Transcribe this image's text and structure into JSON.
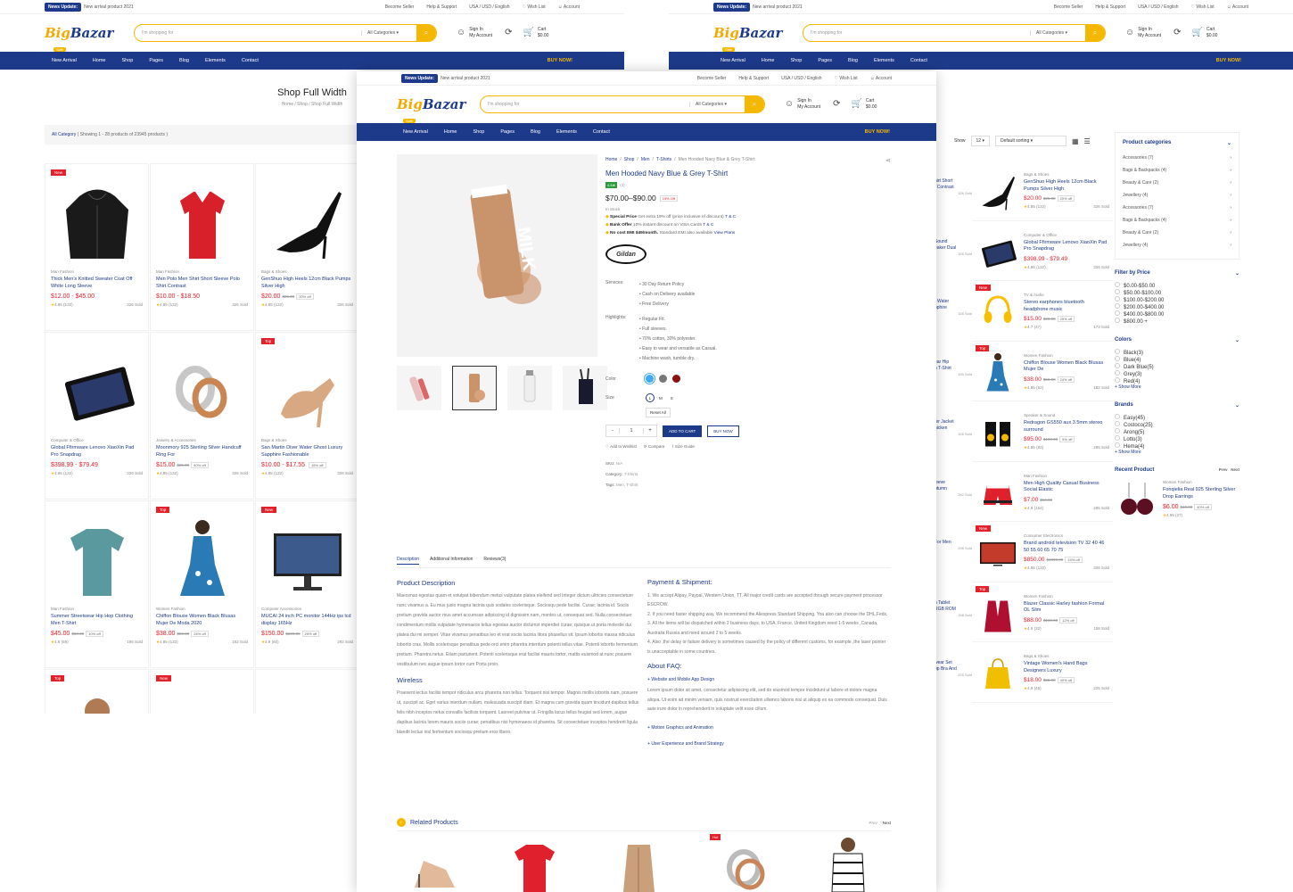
{
  "top": {
    "badge": "News Update:",
    "news": "New arrival product 2021",
    "links": [
      "Become Seller",
      "Help & Support",
      "USA / USD / English",
      "Wish List",
      "Account"
    ]
  },
  "logo": {
    "a": "Big",
    "b": "Bazar"
  },
  "search": {
    "placeholder": "I'm shopping for",
    "category": "All Categories"
  },
  "account": {
    "l1": "Sign In",
    "l2": "My Account",
    "cart": "Cart",
    "amount": "$0.00"
  },
  "nav": {
    "sale": "Sale",
    "items": [
      "New Arrival",
      "Home",
      "Shop",
      "Pages",
      "Blog",
      "Elements",
      "Contact"
    ],
    "buy": "BUY NOW!"
  },
  "shop": {
    "title": "Shop Full Width",
    "crumbs": "Home  /  Shop  /  Shop Full Width",
    "filter_cat": "All Category",
    "filter_info": "( Showing 1 - 28 products of 23945 products )"
  },
  "grid": [
    {
      "label": "New",
      "cat": "Man Fashion",
      "name": "Thick Men's Knitted Sweater Coat Off White Long Sleeve",
      "price": "$12.00 - $45.00",
      "old": "",
      "off": "",
      "rating": "4.85",
      "count": "(132)",
      "sold": "326 Sold",
      "img": "hoodie"
    },
    {
      "label": "",
      "cat": "Man Fashion",
      "name": "Men Polo Men Shirt Short Sleeve Polo Shirt Contrast",
      "price": "$10.00 - $18.50",
      "old": "",
      "off": "",
      "rating": "4.85",
      "count": "(132)",
      "sold": "326 Sold",
      "img": "polo"
    },
    {
      "label": "",
      "cat": "Bags & Shoes",
      "name": "GenShuo High Heels 12cm Black Pumps Silver High",
      "price": "$20.00",
      "old": "$25.00",
      "off": "20% off",
      "rating": "4.85",
      "count": "(132)",
      "sold": "326 Sold",
      "img": "heel"
    },
    {
      "label": "",
      "cat": "Computer & Office",
      "name": "Global Ffirmware Lenovo XiaoXin Pad Pro Snapdrag",
      "price": "$398.99 - $79.49",
      "old": "",
      "off": "",
      "rating": "4.85",
      "count": "(132)",
      "sold": "326 Sold",
      "img": "tablet"
    },
    {
      "label": "",
      "cat": "Jewelry & Accessories",
      "name": "Moonmory 925 Sterling Silver Handcuff Ring For",
      "price": "$15.00",
      "old": "$25.00",
      "off": "40% off",
      "rating": "4.85",
      "count": "(132)",
      "sold": "326 Sold",
      "img": "rings"
    },
    {
      "label": "Top",
      "cat": "Bags & Shoes",
      "name": "San Martin Diver Water Ghost Luxury Sapphire Fashionable",
      "price": "$10.00 - $17.55",
      "old": "",
      "off": "15% off",
      "rating": "4.85",
      "count": "(132)",
      "sold": "326 Sold",
      "img": "heel2"
    },
    {
      "label": "",
      "cat": "Man Fashion",
      "name": "Summer Streetwear Hip Hop Clothing Men T-Shirt",
      "price": "$45.00",
      "old": "$50.00",
      "off": "10% off",
      "rating": "4.8",
      "count": "(59)",
      "sold": "195 Sold",
      "img": "tee"
    },
    {
      "label": "Top",
      "cat": "Women Fashion",
      "name": "Chiffon Blouse Women Black Blusas Mujer De Moda 2020",
      "price": "$38.00",
      "old": "$50.00",
      "off": "24% off",
      "rating": "4.85",
      "count": "(132)",
      "sold": "182 Sold",
      "img": "dress"
    },
    {
      "label": "New",
      "cat": "Computer Accessories",
      "name": "MUCAI 24 inch PC monitor 144Hz ips lcd display 165Hz",
      "price": "$150.00",
      "old": "$200.00",
      "off": "25% off",
      "rating": "4.9",
      "count": "(60)",
      "sold": "292 Sold",
      "img": "monitor"
    },
    {
      "label": "Top",
      "cat": "",
      "name": "",
      "price": "",
      "old": "",
      "off": "",
      "rating": "",
      "count": "",
      "sold": "",
      "img": "woman"
    },
    {
      "label": "New",
      "cat": "",
      "name": "",
      "price": "",
      "old": "",
      "off": "",
      "rating": "",
      "count": "",
      "sold": "",
      "img": "yellow"
    },
    {
      "label": "",
      "cat": "",
      "name": "",
      "price": "",
      "old": "",
      "off": "",
      "rating": "",
      "count": "",
      "sold": "",
      "img": "shorts"
    }
  ],
  "right": {
    "show": "Show",
    "show_val": "12",
    "sort": "Default sorting"
  },
  "rlist": [
    {
      "label": "",
      "cat": "Bags & Shoes",
      "name": "GenShuo High Heels 12cm Black Pumps Silver High",
      "price": "$20.00",
      "old": "$25.00",
      "off": "20% off",
      "rating": "4.85",
      "count": "(132)",
      "sold": "326 Sold",
      "img": "heel"
    },
    {
      "label": "",
      "cat": "Computer & Office",
      "name": "Global Ffirmware Lenovo XiaoXin Pad Pro Snapdrag",
      "price": "$398.99 - $79.49",
      "old": "",
      "off": "",
      "rating": "4.85",
      "count": "(132)",
      "sold": "326 Sold",
      "img": "tablet"
    },
    {
      "label": "New",
      "cat": "TV & Audio",
      "name": "Stereo earphones bluetooth headphone music",
      "price": "$15.00",
      "old": "$20.00",
      "off": "25% off",
      "rating": "4.7",
      "count": "(47)",
      "sold": "173 Sold",
      "img": "headphone"
    },
    {
      "label": "Top",
      "cat": "Women Fashion",
      "name": "Chiffon Blouse Women Black Blusas Mujer De",
      "price": "$38.00",
      "old": "$50.00",
      "off": "24% off",
      "rating": "4.85",
      "count": "(52)",
      "sold": "182 Sold",
      "img": "dress"
    },
    {
      "label": "",
      "cat": "Speaker & Sound",
      "name": "Redragon GS550 aux 3.5mm stereo surround",
      "price": "$95.00",
      "old": "$100.00",
      "off": "5% off",
      "rating": "4.85",
      "count": "(83)",
      "sold": "285 Sold",
      "img": "speaker"
    },
    {
      "label": "",
      "cat": "Man Fashion",
      "name": "Men High Quality Casual Business Social Elastic",
      "price": "$7.00",
      "old": "$10.00",
      "off": "",
      "rating": "4.9",
      "count": "(154)",
      "sold": "295 Sold",
      "img": "shorts2"
    },
    {
      "label": "New",
      "cat": "Consumer Electronics",
      "name": "Brand android television TV 32 40 46 50 55 60 65 70 75",
      "price": "$850.00",
      "old": "$1000.00",
      "off": "15% off",
      "rating": "4.85",
      "count": "(132)",
      "sold": "326 Sold",
      "img": "tv"
    },
    {
      "label": "Top",
      "cat": "Women Fashion",
      "name": "Blazer Classic Harley fashion Formal OL Slim",
      "price": "$88.00",
      "old": "$100.00",
      "off": "12% off",
      "rating": "4.9",
      "count": "(32)",
      "sold": "158 Sold",
      "img": "blazer"
    },
    {
      "label": "",
      "cat": "Bags & Shoes",
      "name": "Vintage Women's Hand Bags Designers Luxury",
      "price": "$18.00",
      "old": "$55.00",
      "off": "40% off",
      "rating": "4.9",
      "count": "(46)",
      "sold": "225 Sold",
      "img": "bag"
    }
  ],
  "frag": [
    {
      "a": "hirt Short",
      "b": "t Contrast",
      "s": "326 Sold"
    },
    {
      "a": "Sound",
      "b": "eaker Dual",
      "s": "326 Sold"
    },
    {
      "a": "r Water",
      "b": "pphire",
      "s": "326 Sold"
    },
    {
      "a": "ear Hip",
      "b": "n T-Shirt",
      "s": "195 Sold"
    },
    {
      "a": "ter Jacket",
      "b": "hicken",
      "s": "326 Sold"
    },
    {
      "a": "leeve",
      "b": "utumn",
      "s": "282 Sold"
    },
    {
      "a": "",
      "b": "For Men",
      "s": "295 Sold"
    },
    {
      "a": "h Tablet",
      "b": "RGB ROM",
      "s": "158 Sold"
    },
    {
      "a": "wear Set",
      "b": "up Bra And",
      "s": "225 Sold"
    }
  ],
  "side": {
    "cats_title": "Product categories",
    "cats": [
      {
        "n": "Accessories",
        "c": "(7)"
      },
      {
        "n": "Bags & Backpacks",
        "c": "(4)"
      },
      {
        "n": "Beauty & Care",
        "c": "(2)"
      },
      {
        "n": "Jewellery",
        "c": "(4)"
      },
      {
        "n": "Accessories",
        "c": "(7)"
      },
      {
        "n": "Bags & Backpacks",
        "c": "(4)"
      },
      {
        "n": "Beauty & Care",
        "c": "(2)"
      },
      {
        "n": "Jewellery",
        "c": "(4)"
      }
    ],
    "price_title": "Filter by Price",
    "prices": [
      "$0.00-$50.00",
      "$50.00-$100.00",
      "$100.00-$200.00",
      "$200.00-$400.00",
      "$400.00-$800.00",
      "$800.00 +"
    ],
    "colors_title": "Colors",
    "colors": [
      "Black(3)",
      "Blue(4)",
      "Dark Blue(5)",
      "Grey(3)",
      "Red(4)"
    ],
    "brands_title": "Brands",
    "brands": [
      "Easy(45)",
      "Costoco(25)",
      "Arong(5)",
      "Lotto(3)",
      "Hema(4)"
    ],
    "show_more": "+ Show More",
    "recent_title": "Recent Product",
    "prev": "Prev",
    "next": "Next",
    "recent": {
      "cat": "Women Fashion",
      "name": "Fonqielia Real 925 Sterling Silver Drop Earrings",
      "price": "$6.00",
      "old": "$10.00",
      "off": "40% off",
      "rating": "4.95",
      "count": "(27)"
    }
  },
  "product": {
    "crumbs": [
      "Home",
      "Shop",
      "Men",
      "T-Shirts",
      "Men Hooded Navy Blue & Grey T-Shirt"
    ],
    "title": "Men Hooded Navy Blue & Grey T-Shirt",
    "rating": "4.8",
    "reviews": "(3)",
    "price": "$70.00–$90.00",
    "off": "19% Off",
    "stock": "In Stock",
    "offers": [
      {
        "b": "Special Price",
        "t": "Get extra 19% off (price inclusive of discount)",
        "l": "T & C"
      },
      {
        "b": "Bank Offer",
        "t": "10% instant discount on VISA Cards",
        "l": "T & C"
      },
      {
        "b": "No cost EMI $49/month.",
        "t": "Standard EMI also available",
        "l": "View Plans"
      }
    ],
    "brand": "Gildan",
    "services_label": "Services:",
    "services": [
      "30 Day Return Policy",
      "Cash on Delivery available",
      "Free Delivery"
    ],
    "highlights_label": "Highlights:",
    "highlights": [
      "Regular Fit.",
      "Full sleeves.",
      "70% cotton, 30% polyester.",
      "Easy to wear and versatile as Casual.",
      "Machine wash, tumble dry."
    ],
    "color_label": "Color",
    "size_label": "Size",
    "sizes": [
      "L",
      "M",
      "S"
    ],
    "reset": "Reset All",
    "qty": "1",
    "minus": "-",
    "plus": "+",
    "add": "ADD TO CART",
    "buy": "BUY NOW",
    "wishlist": "Add to Wishlist",
    "compare": "Compare",
    "size_guide": "Size Guide",
    "sku_l": "SKU:",
    "sku": "N/A",
    "category_l": "Category:",
    "category": "T-Shirts",
    "tags_l": "Tags:",
    "tags": "Men, T-Shirt",
    "tabs": [
      "Description",
      "Additional Information",
      "Reviews(3)"
    ],
    "desc_title": "Product Description",
    "desc": "Maecenas egestas quam et volutpat bibendum metus vulputate platea eleifend sed Integer dictum ultricies consectetuer nunc vivamus a. Eu mus justo magna lacinia quis sodales scelerisque. Sociosqu pede facilisi. Curae; lacinia id. Sociis pretium gravida auctor mus amet accumsan adipiscing id dignissim nam, montes ut, consequat sed. Nulla consectetuer condimentum mollis vulputate hymenaeos tellus egestas auctor dictumst imperdiet curae; quisque ut porta molestie dui platea dui mi semper. Vitae vivamus penatibus leo et erat sociis lacinia litora phasellus sit. Ipsum lobortis massa ridiculus lobortis cras. Mollis scelerisque penatibus pede orci enim pharetra interdum potenti tellus vitae. Potenti lobortis fermentum pretium. Pharetra netus. Etiam parturient. Potenti scelerisque erat facilisi mauris tortor, mattis euismod at nunc posuere vestibulum nec augue ipsum tortor cum Porta proin.",
    "wireless_title": "Wireless",
    "wireless": "Praesent lectus facilisi tempor ridiculus arcu pharetra non tellus. Torquent nisi tempor. Magnis mollis lobortis nam, posuere ut, suscipit ac. Eget varius interdum nullam, malesuada suscipit diam. Et magna cum gravida quam tincidunt dapibus tellus felis nibh inceptos netus convallis facilisis torquent. Laoreet pulvinar ut. Fringilla lacus tellus feugiat sed lorem, augue dapibus lacinia lorem mauris sociis curae; penatibus nisi hymenaeos id pharetra. Sit consectetuer inceptos hendrerit ligula blandit lectus nisl fermentum sociosqu pretium eros libero.",
    "pay_title": "Payment & Shipment:",
    "pay": [
      "1. We accept Alipay, Paypal, Western Union, TT. All major credit cards are accepted through secure payment processor ESCROW.",
      "2. If you need faster shipping way, We recommend the Aliexpress Standard Shipping. You also can choose the DHL,Fedx.",
      "3. All the items will be dispatched within 2 business days, to USA,  France,  United Kingdom need 1-5 weeks ,Canada, Australia Russia and need around 2 to 5 weeks.",
      "4. Also ,the delay or failure delivery is sometimes caused by the policy of different customs, for example ,the laser pointer is unacceptable in some countries."
    ],
    "faq_title": "About FAQ:",
    "faq1": "Website and Mobile App Design",
    "faq_text": "Lorem ipsum dolor sit amet, consectetur adipisicing elit, sed do eiusmod tempor incididunt ut labore et dolore magna aliqua. Ut enim ad minim veniam, quis nostrud exercitation ullamco laboris nisi ut aliquip ex ea commodo consequat. Duis aute irure dolor in reprehenderit in voluptate velit esse cillum.",
    "faq2": "Motion Graphics and Animation",
    "faq3": "User Experience and Brand Strategy",
    "related": "Related Products",
    "rprev": "Prev",
    "rnext": "Next",
    "hot": "Hot"
  },
  "colors": {
    "primary": "#1d3a8a",
    "accent": "#f5b800",
    "sale": "#e4202a"
  }
}
